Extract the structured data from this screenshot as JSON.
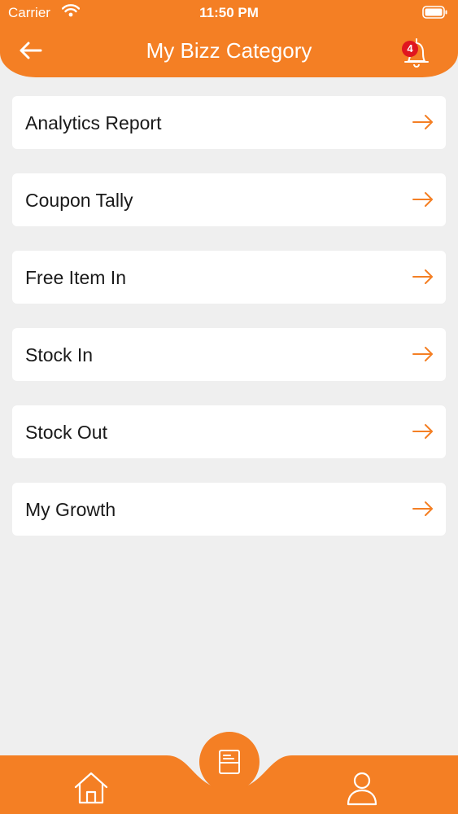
{
  "status_bar": {
    "carrier": "Carrier",
    "time": "11:50 PM"
  },
  "header": {
    "title": "My Bizz Category",
    "notification_count": "4"
  },
  "menu": {
    "items": [
      {
        "label": "Analytics Report"
      },
      {
        "label": "Coupon Tally"
      },
      {
        "label": "Free Item In"
      },
      {
        "label": "Stock In"
      },
      {
        "label": "Stock Out"
      },
      {
        "label": "My Growth"
      }
    ]
  },
  "icons": {
    "back": "arrow-left-icon",
    "notifications": "bell-icon",
    "item_arrow": "arrow-right-icon",
    "home": "home-icon",
    "center": "document-icon",
    "profile": "user-icon"
  },
  "colors": {
    "brand": "#f47f24",
    "background": "#efefef",
    "badge": "#e0161f",
    "card": "#ffffff"
  }
}
